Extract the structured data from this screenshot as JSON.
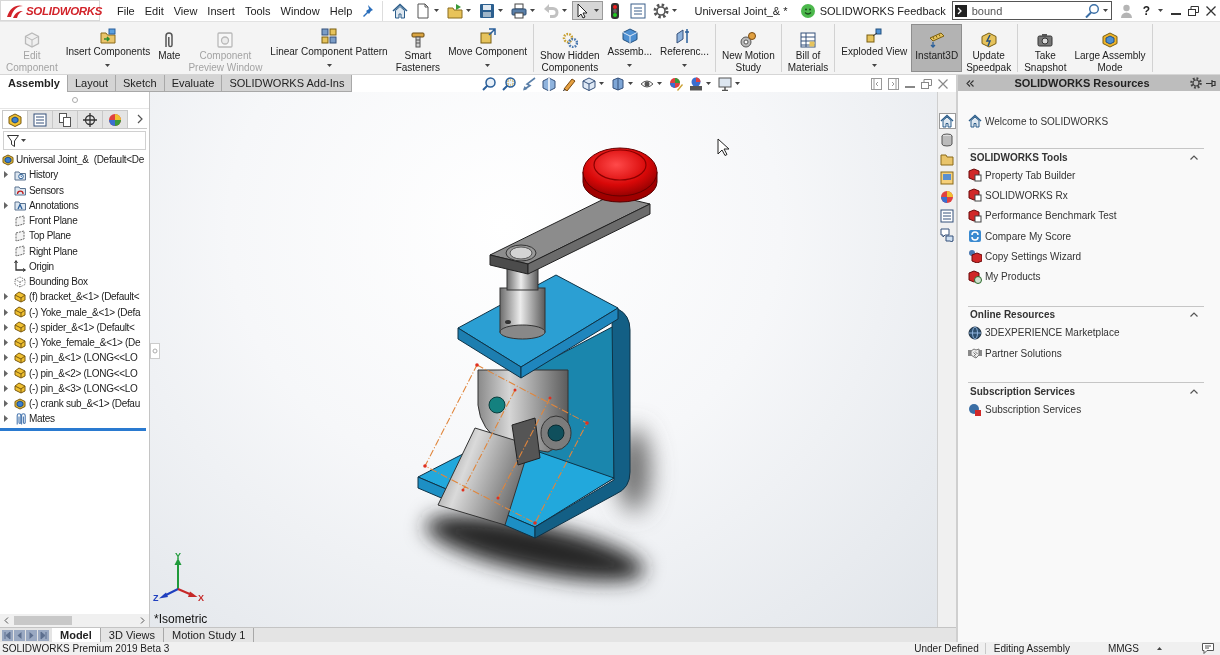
{
  "app": {
    "logo": "SOLIDWORKS"
  },
  "menu": [
    "File",
    "Edit",
    "View",
    "Insert",
    "Tools",
    "Window",
    "Help"
  ],
  "quick_access_toolbar": [
    {
      "dropdown": false,
      "disabled": false,
      "pressed": false
    },
    {
      "dropdown": true,
      "disabled": false,
      "pressed": false
    },
    {
      "dropdown": true,
      "disabled": false,
      "pressed": false
    },
    {
      "dropdown": true,
      "disabled": false,
      "pressed": false
    },
    {
      "dropdown": true,
      "disabled": false,
      "pressed": false
    },
    {
      "dropdown": true,
      "disabled": true,
      "pressed": false
    },
    {
      "dropdown": true,
      "disabled": false,
      "pressed": true
    },
    {
      "dropdown": false,
      "disabled": false,
      "pressed": false
    },
    {
      "dropdown": false,
      "disabled": false,
      "pressed": false
    },
    {
      "dropdown": true,
      "disabled": false,
      "pressed": false
    }
  ],
  "window": {
    "title": "Universal Joint_& *"
  },
  "feedback": {
    "label": "SOLIDWORKS Feedback"
  },
  "search": {
    "value": "bound"
  },
  "help": {
    "label": "?"
  },
  "command_groups": [
    {
      "buttons": [
        {
          "label": "Edit\nComponent",
          "dropdown": false,
          "disabled": true,
          "selected": false
        },
        {
          "label": "Insert Components",
          "dropdown": true,
          "disabled": false,
          "selected": false
        },
        {
          "label": "Mate",
          "dropdown": false,
          "disabled": false,
          "selected": false
        },
        {
          "label": "Component\nPreview Window",
          "dropdown": false,
          "disabled": true,
          "selected": false
        },
        {
          "label": "Linear Component Pattern",
          "dropdown": true,
          "disabled": false,
          "selected": false
        },
        {
          "label": "Smart\nFasteners",
          "dropdown": false,
          "disabled": false,
          "selected": false
        },
        {
          "label": "Move Component",
          "dropdown": true,
          "disabled": false,
          "selected": false
        }
      ]
    },
    {
      "buttons": [
        {
          "label": "Show Hidden\nComponents",
          "dropdown": false,
          "disabled": false,
          "selected": false
        },
        {
          "label": "Assemb...",
          "dropdown": true,
          "disabled": false,
          "selected": false
        },
        {
          "label": "Referenc...",
          "dropdown": true,
          "disabled": false,
          "selected": false
        }
      ]
    },
    {
      "buttons": [
        {
          "label": "New Motion\nStudy",
          "dropdown": false,
          "disabled": false,
          "selected": false
        }
      ]
    },
    {
      "buttons": [
        {
          "label": "Bill of\nMaterials",
          "dropdown": false,
          "disabled": false,
          "selected": false
        }
      ]
    },
    {
      "buttons": [
        {
          "label": "Exploded View",
          "dropdown": true,
          "disabled": false,
          "selected": false
        },
        {
          "label": "Instant3D",
          "dropdown": false,
          "disabled": false,
          "selected": true
        },
        {
          "label": "Update\nSpeedpak",
          "dropdown": false,
          "disabled": false,
          "selected": false
        }
      ]
    },
    {
      "buttons": [
        {
          "label": "Take\nSnapshot",
          "dropdown": false,
          "disabled": false,
          "selected": false
        },
        {
          "label": "Large Assembly\nMode",
          "dropdown": false,
          "disabled": false,
          "selected": false
        }
      ]
    }
  ],
  "tabs": [
    {
      "label": "Assembly",
      "selected": true
    },
    {
      "label": "Layout",
      "selected": false
    },
    {
      "label": "Sketch",
      "selected": false
    },
    {
      "label": "Evaluate",
      "selected": false
    },
    {
      "label": "SOLIDWORKS Add-Ins",
      "selected": false
    }
  ],
  "view_toolbar": [
    {
      "dropdown": false
    },
    {
      "dropdown": false
    },
    {
      "dropdown": false
    },
    {
      "dropdown": false
    },
    {
      "dropdown": false
    },
    {
      "dropdown": true
    },
    {
      "dropdown": true
    },
    {
      "dropdown": true
    },
    {
      "dropdown": false
    },
    {
      "dropdown": true
    },
    {
      "dropdown": true
    }
  ],
  "feature_manager": {
    "tabs": [
      {
        "selected": true
      },
      {
        "selected": false
      },
      {
        "selected": false
      },
      {
        "selected": false
      },
      {
        "selected": false
      }
    ],
    "tree": {
      "label": "Universal Joint_&  (Default<De",
      "kind": "assembly",
      "children": [
        {
          "label": "History",
          "kind": "history",
          "expandable": true
        },
        {
          "label": "Sensors",
          "kind": "sensors",
          "expandable": false
        },
        {
          "label": "Annotations",
          "kind": "annotations",
          "expandable": true
        },
        {
          "label": "Front Plane",
          "kind": "plane",
          "expandable": false
        },
        {
          "label": "Top Plane",
          "kind": "plane",
          "expandable": false
        },
        {
          "label": "Right Plane",
          "kind": "plane",
          "expandable": false
        },
        {
          "label": "Origin",
          "kind": "origin",
          "expandable": false
        },
        {
          "label": "Bounding Box",
          "kind": "bounding-box",
          "expandable": false
        },
        {
          "label": "(f) bracket_&<1> (Default<",
          "kind": "part",
          "expandable": true
        },
        {
          "label": "(-) Yoke_male_&<1> (Defa",
          "kind": "part",
          "expandable": true
        },
        {
          "label": "(-) spider_&<1> (Default<",
          "kind": "part",
          "expandable": true
        },
        {
          "label": "(-) Yoke_female_&<1> (De",
          "kind": "part",
          "expandable": true
        },
        {
          "label": "(-) pin_&<1> (LONG<<LO",
          "kind": "part",
          "expandable": true
        },
        {
          "label": "(-) pin_&<2> (LONG<<LO",
          "kind": "part",
          "expandable": true
        },
        {
          "label": "(-) pin_&<3> (LONG<<LO",
          "kind": "part",
          "expandable": true
        },
        {
          "label": "(-) crank sub_&<1> (Defau",
          "kind": "assembly",
          "expandable": true
        },
        {
          "label": "Mates",
          "kind": "mates",
          "expandable": true
        }
      ]
    }
  },
  "viewport": {
    "view_label": "*Isometric",
    "triad": [
      {
        "label": "Y",
        "color": "#1f9a3a"
      },
      {
        "label": "Z",
        "color": "#1f3fbf"
      },
      {
        "label": "X",
        "color": "#c62828"
      }
    ]
  },
  "task_pane_tabs": [
    {
      "selected": true
    },
    {
      "selected": false
    },
    {
      "selected": false
    },
    {
      "selected": false
    },
    {
      "selected": false
    },
    {
      "selected": false
    },
    {
      "selected": false
    }
  ],
  "resources": {
    "title": "SOLIDWORKS Resources",
    "welcome": "Welcome to SOLIDWORKS",
    "sections": [
      {
        "title": "SOLIDWORKS Tools",
        "expanded": true,
        "items": [
          "Property Tab Builder",
          "SOLIDWORKS Rx",
          "Performance Benchmark Test",
          "Compare My Score",
          "Copy Settings Wizard",
          "My Products"
        ]
      },
      {
        "title": "Online Resources",
        "expanded": true,
        "items": [
          "3DEXPERIENCE Marketplace",
          "Partner Solutions"
        ]
      },
      {
        "title": "Subscription Services",
        "expanded": true,
        "items": [
          "Subscription Services"
        ]
      }
    ]
  },
  "bottom_tabs": [
    {
      "label": "Model",
      "selected": true
    },
    {
      "label": "3D Views",
      "selected": false
    },
    {
      "label": "Motion Study 1",
      "selected": false
    }
  ],
  "status_bar": {
    "product": "SOLIDWORKS Premium 2019 Beta 3",
    "state": "Under Defined",
    "mode": "Editing Assembly",
    "units": "MMGS"
  }
}
